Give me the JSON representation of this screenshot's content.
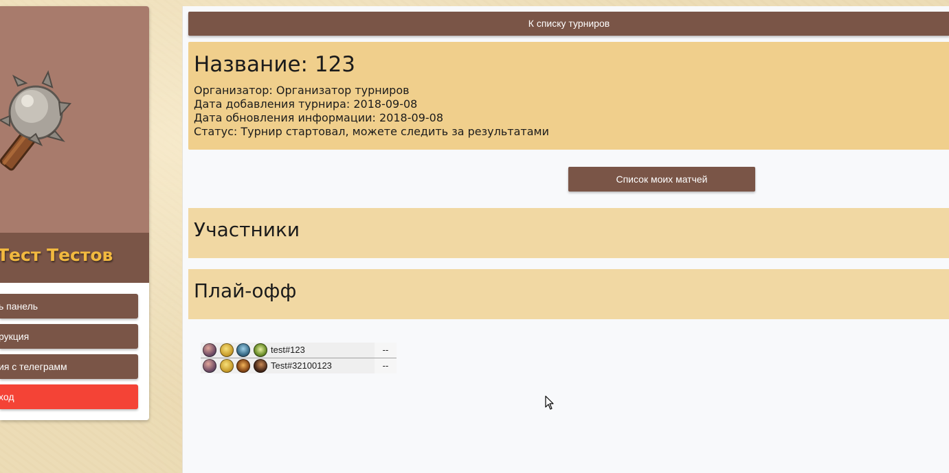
{
  "sidebar": {
    "username": "Тест Тестов",
    "avatar_icon": "mace-icon",
    "menu": [
      {
        "label": "ь панель",
        "style": "brown"
      },
      {
        "label": "рукция",
        "style": "brown"
      },
      {
        "label": "ия с телеграмм",
        "style": "brown"
      },
      {
        "label": "ход",
        "style": "red"
      }
    ]
  },
  "main": {
    "back_button": "К списку турниров",
    "tournament": {
      "title": "Название: 123",
      "organizer": "Организатор: Организатор турниров",
      "date_added": "Дата добавления турнира: 2018-09-08",
      "date_updated": "Дата обновления информации: 2018-09-08",
      "status": "Статус: Турнир стартовал, можете следить за результатами"
    },
    "my_matches_button": "Список моих матчей",
    "participants_title": "Участники",
    "playoff_title": "Плай-офф",
    "bracket": {
      "teams": [
        {
          "name": "test#123",
          "score": "--",
          "icons": [
            "hero-portrait-icon",
            "gold-shield-icon",
            "blue-wing-icon",
            "green-leaf-icon"
          ]
        },
        {
          "name": "Test#32100123",
          "score": "--",
          "icons": [
            "hero-portrait-icon",
            "gold-shield-icon",
            "bronze-emblem-icon",
            "dark-claw-icon"
          ]
        }
      ]
    }
  },
  "colors": {
    "brown": "#7a5547",
    "avatar_bg": "#a87b6c",
    "info_card": "#f0cf8c",
    "section_bg": "#f1d8a3",
    "logout_red": "#f44336",
    "username_gold": "#f2b93f"
  }
}
